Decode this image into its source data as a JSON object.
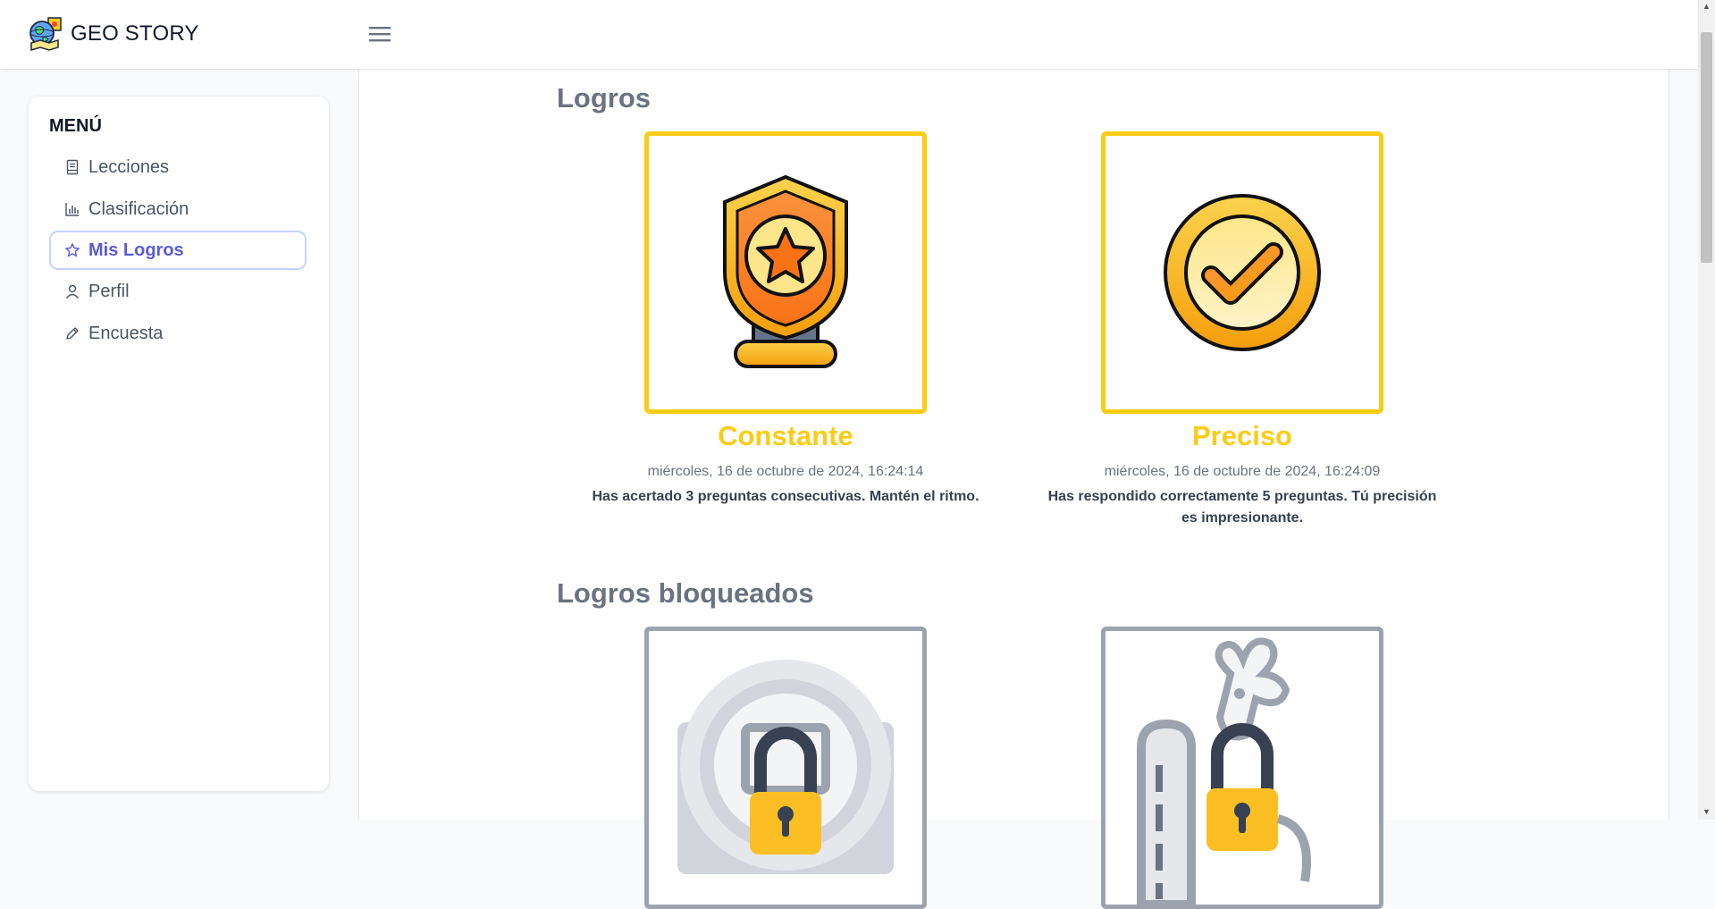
{
  "header": {
    "brand": "GEO STORY",
    "logo_icon": "globe-map-icon",
    "menu_icon": "hamburger-icon"
  },
  "sidebar": {
    "title": "MENÚ",
    "items": [
      {
        "label": "Lecciones",
        "icon": "book-icon",
        "active": false
      },
      {
        "label": "Clasificación",
        "icon": "bar-chart-icon",
        "active": false
      },
      {
        "label": "Mis Logros",
        "icon": "star-icon",
        "active": true
      },
      {
        "label": "Perfil",
        "icon": "user-icon",
        "active": false
      },
      {
        "label": "Encuesta",
        "icon": "pencil-icon",
        "active": false
      }
    ]
  },
  "main": {
    "achievements_title": "Logros",
    "achievements": [
      {
        "name": "Constante",
        "date": "miércoles, 16 de octubre de 2024, 16:24:14",
        "description": "Has acertado 3 preguntas consecutivas. Mantén el ritmo.",
        "icon": "shield-star-trophy-icon"
      },
      {
        "name": "Preciso",
        "date": "miércoles, 16 de octubre de 2024, 16:24:09",
        "description": "Has respondido correctamente 5 preguntas. Tú precisión es impresionante.",
        "icon": "checkmark-medal-icon"
      }
    ],
    "locked_title": "Logros bloqueados",
    "locked": [
      {
        "icon": "locked-coin-icon"
      },
      {
        "icon": "locked-crown-icon"
      }
    ]
  },
  "colors": {
    "accent": "#5b5bd6",
    "achievement_gold": "#facc15",
    "locked_gray": "#9ca3af",
    "title_gray": "#6b7280"
  }
}
